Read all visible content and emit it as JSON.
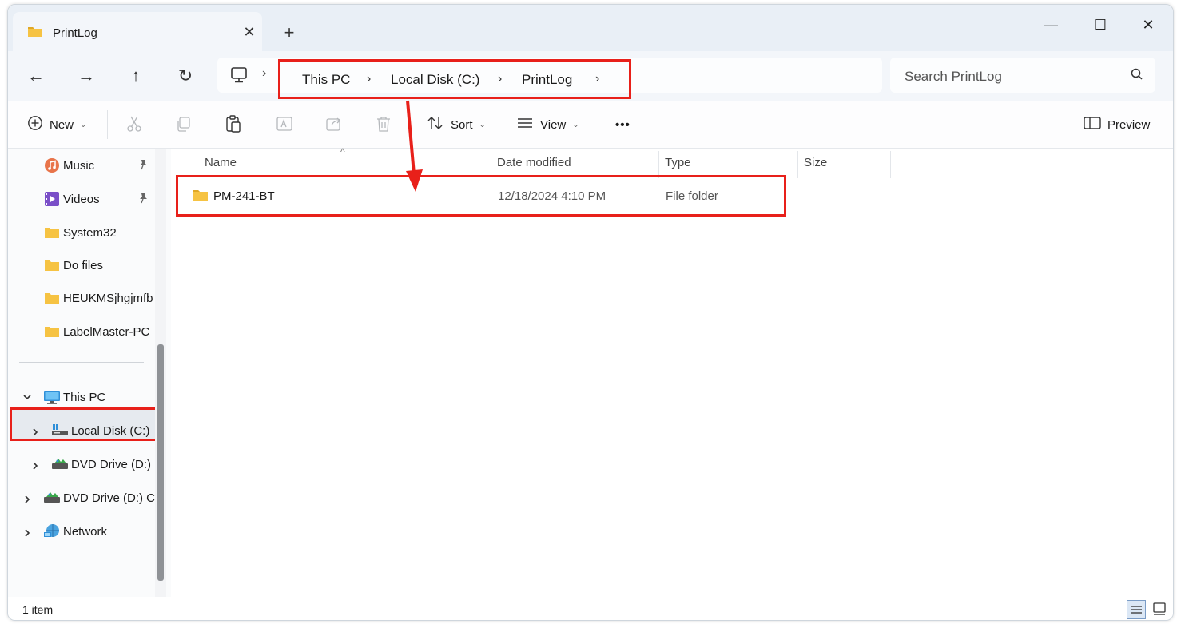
{
  "window": {
    "tab_title": "PrintLog",
    "tab_close": "✕",
    "new_tab": "+",
    "minimize": "—",
    "maximize": "☐",
    "close": "✕"
  },
  "nav": {
    "back": "←",
    "forward": "→",
    "up": "↑",
    "refresh": "↻"
  },
  "breadcrumb": {
    "items": [
      "This PC",
      "Local Disk (C:)",
      "PrintLog"
    ],
    "separator": "›"
  },
  "search": {
    "placeholder": "Search PrintLog"
  },
  "toolbar": {
    "new_label": "New",
    "sort_label": "Sort",
    "view_label": "View",
    "more": "•••",
    "preview_label": "Preview",
    "chevron": "⌄"
  },
  "sidebar": {
    "quick": [
      {
        "label": "Music",
        "icon": "music-icon",
        "pinned": true
      },
      {
        "label": "Videos",
        "icon": "video-icon",
        "pinned": true
      },
      {
        "label": "System32",
        "icon": "folder-icon"
      },
      {
        "label": "Do files",
        "icon": "folder-icon"
      },
      {
        "label": "HEUKMSjhgjmfb",
        "icon": "folder-icon"
      },
      {
        "label": "LabelMaster-PC",
        "icon": "folder-icon"
      }
    ],
    "tree": [
      {
        "label": "This PC",
        "icon": "computer-icon",
        "expanded": true
      },
      {
        "label": "Local Disk (C:)",
        "icon": "drive-icon",
        "selected": true
      },
      {
        "label": "DVD Drive (D:)",
        "icon": "dvd-icon"
      },
      {
        "label": "DVD Drive (D:) C",
        "icon": "dvd-icon"
      },
      {
        "label": "Network",
        "icon": "network-icon"
      }
    ],
    "pin_glyph": "📌"
  },
  "columns": {
    "name": "Name",
    "date": "Date modified",
    "type": "Type",
    "size": "Size",
    "sort_caret": "^"
  },
  "files": [
    {
      "name": "PM-241-BT",
      "date": "12/18/2024 4:10 PM",
      "type": "File folder",
      "size": ""
    }
  ],
  "status": {
    "count": "1 item"
  },
  "colors": {
    "annotation_red": "#e8201a",
    "folder_yellow": "#f6c343",
    "titlebar_bg": "#e9eff6"
  }
}
